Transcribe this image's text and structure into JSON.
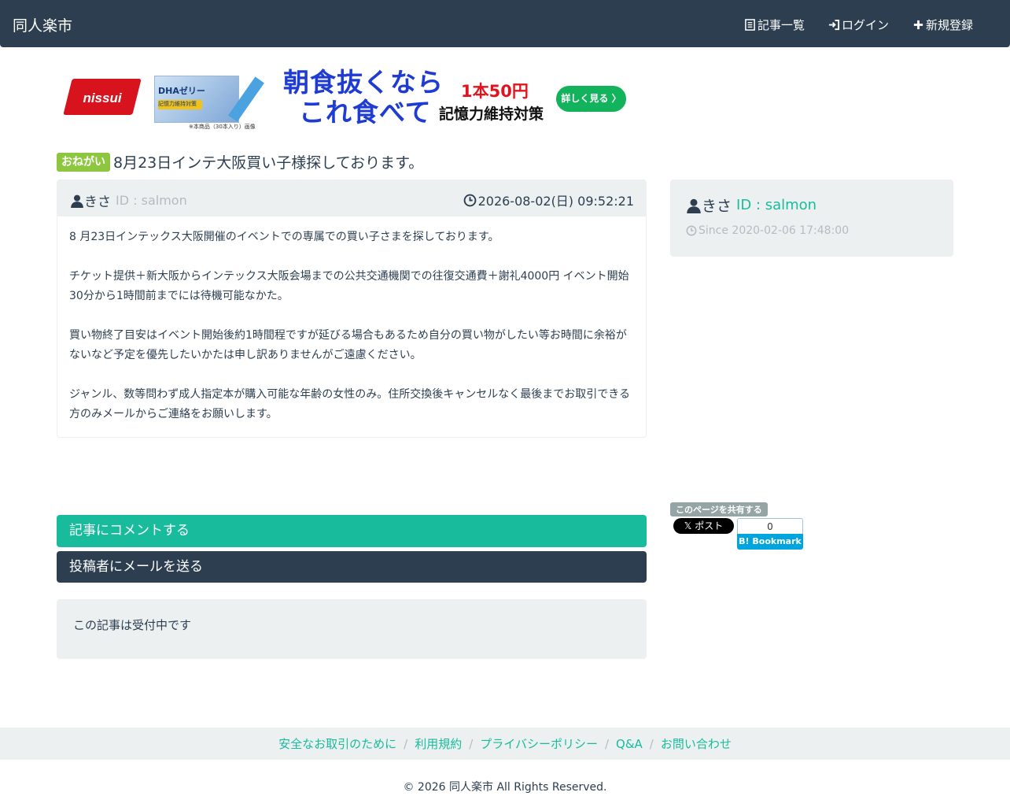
{
  "navbar": {
    "brand": "同人楽市",
    "items": [
      {
        "icon": "list-icon",
        "label": "記事一覧"
      },
      {
        "icon": "login-icon",
        "label": "ログイン"
      },
      {
        "icon": "plus-icon",
        "label": "新規登録"
      }
    ]
  },
  "ad": {
    "logo": "nissui",
    "product_name": "DHAゼリー",
    "product_badge": "記憶力維持対策",
    "product_caption": "※本商品（30本入り）画像",
    "headline_1": "朝食抜くなら",
    "headline_2": "これ食べて",
    "price": "1本50円",
    "subline": "記憶力維持対策",
    "cta": "詳しく見る 〉"
  },
  "post": {
    "tag": "おねがい",
    "title": "8月23日インテ大阪買い子様探しております。",
    "author": "きさ",
    "author_id": "ID : salmon",
    "date": "2026-08-02(日) 09:52:21",
    "paragraphs": [
      "8 月23日インテックス大阪開催のイベントでの専属での買い子さまを探しております。",
      "チケット提供＋新大阪からインテックス大阪会場までの公共交通機関での往復交通費＋謝礼4000円 イベント開始30分から1時間前までには待機可能なかた。",
      "買い物終了目安はイベント開始後約1時間程ですが延びる場合もあるため自分の買い物がしたい等お時間に余裕がないなど予定を優先したいかたは申し訳ありませんがご遠慮ください。",
      "ジャンル、数等問わず成人指定本が購入可能な年齢の女性のみ。住所交換後キャンセルなく最後までお取引できる方のみメールからご連絡をお願いします。"
    ]
  },
  "sidebar": {
    "author": "きさ",
    "author_id": "ID : salmon",
    "since": "Since 2020-02-06 17:48:00",
    "share_label": "このページを共有する",
    "x_post": "𝕏 ポスト",
    "bookmark_count": "0",
    "bookmark_label": "B! Bookmark"
  },
  "actions": {
    "comment": "記事にコメントする",
    "mail": "投稿者にメールを送る"
  },
  "status": "この記事は受付中です",
  "footer": {
    "links": [
      "安全なお取引のために",
      "利用規約",
      "プライバシーポリシー",
      "Q&A",
      "お問い合わせ"
    ],
    "separator": "/",
    "copyright": "© 2026 同人楽市 All Rights Reserved."
  },
  "colors": {
    "navbar": "#2c3e50",
    "accent": "#18bc9c",
    "tag": "#8dc63f",
    "well": "#ecf0f1"
  }
}
